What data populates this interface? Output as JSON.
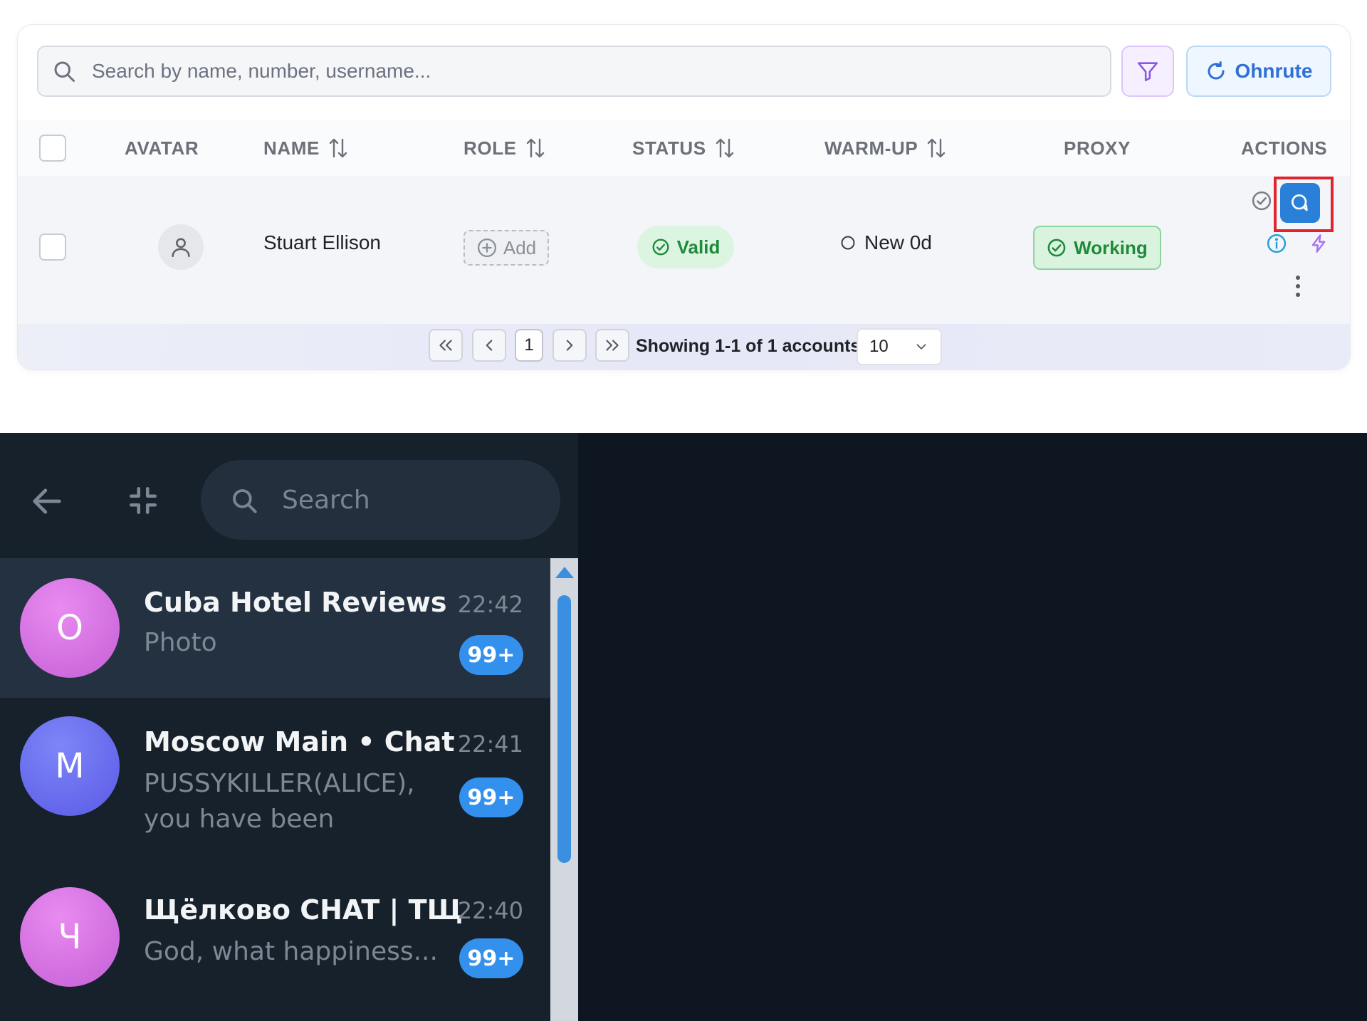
{
  "top_panel": {
    "search": {
      "placeholder": "Search by name, number, username..."
    },
    "refresh_label": "Ohnrute",
    "columns": {
      "avatar": "AVATAR",
      "name": "NAME",
      "role": "ROLE",
      "status": "STATUS",
      "warmup": "WARM-UP",
      "proxy": "PROXY",
      "actions": "ACTIONS"
    },
    "row": {
      "name": "Stuart Ellison",
      "role_add": "Add",
      "status": "Valid",
      "warmup": "New 0d",
      "proxy": "Working"
    },
    "pagination": {
      "current_page": "1",
      "showing": "Showing 1-1 of 1 accounts",
      "per_page": "10"
    },
    "colors": {
      "accent_blue": "#2a7fd8",
      "valid_green": "#1f8a3b",
      "highlight_red": "#e0232e"
    }
  },
  "telegram": {
    "search": {
      "placeholder": "Search"
    },
    "chats": [
      {
        "initial": "O",
        "title": "Cuba Hotel Reviews",
        "message": "Photo",
        "time": "22:42",
        "badge": "99+",
        "avatar_color": "#d66de0"
      },
      {
        "initial": "M",
        "title": "Moscow Main • Chat",
        "message": "PUSSYKILLER(ALICE), you have been promoted...",
        "time": "22:41",
        "badge": "99+",
        "avatar_color": "#6a6ef0"
      },
      {
        "initial": "Ч",
        "title": "Щёлково CHAT | ТЩ",
        "message": "God, what happiness...",
        "time": "22:40",
        "badge": "99+",
        "avatar_color": "#d66de0"
      }
    ],
    "colors": {
      "badge": "#3390ec",
      "sidebar_bg": "#17212b"
    }
  }
}
